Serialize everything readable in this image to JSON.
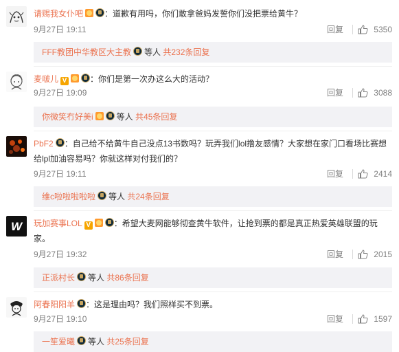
{
  "comments": [
    {
      "username": "请赐我女仆吧",
      "text": "：道歉有用吗，你们敢拿爸妈发誓你们没把票给黄牛？",
      "time": "9月27日 19:11",
      "reply_label": "回复",
      "likes": "5350",
      "badges": [
        "vip-badge",
        "lol-badge"
      ],
      "thread": {
        "user": "FFF教团中华教区大主教",
        "people": "等人",
        "count": "共232条回复"
      }
    },
    {
      "username": "麦啵儿",
      "text": "：你们是第一次办这么大的活动？",
      "time": "9月27日 19:09",
      "reply_label": "回复",
      "likes": "3088",
      "badges": [
        "v-badge",
        "vip-badge",
        "lol-badge"
      ],
      "v_char": "V",
      "thread": {
        "user": "你微笑冇好美i",
        "people": "等人",
        "count": "共45条回复"
      }
    },
    {
      "username": "PbF2",
      "text": "：自己给不给黄牛自己没点13书数吗？玩弄我们lol撸友感情？大家想在家门口看场比赛想给lpl加油容易吗？你就这样对付我们的？",
      "time": "9月27日 19:11",
      "reply_label": "回复",
      "likes": "2414",
      "badges": [
        "lol-badge"
      ],
      "thread": {
        "user": "维c啦啦啦啦啦",
        "people": "等人",
        "count": "共24条回复"
      }
    },
    {
      "username": "玩加赛事LOL",
      "text": "：希望大麦网能够彻查黄牛软件，让抢到票的都是真正热爱英雄联盟的玩家。",
      "time": "9月27日 19:32",
      "reply_label": "回复",
      "likes": "2015",
      "badges": [
        "v-badge",
        "vip-badge",
        "lol-badge"
      ],
      "v_char": "V",
      "thread": {
        "user": "正派村长",
        "people": "等人",
        "count": "共86条回复"
      }
    },
    {
      "username": "阿春阳阳羊",
      "text": "：这是理由吗？我们照样买不到票。",
      "time": "9月27日 19:10",
      "reply_label": "回复",
      "likes": "1597",
      "badges": [
        "lol-badge"
      ],
      "thread": {
        "user": "一笙爱曦",
        "people": "等人",
        "count": "共25条回复"
      }
    }
  ],
  "avatar_logo_text": "W",
  "colors": {
    "username": "#eb7350",
    "text": "#333333",
    "meta": "#808080",
    "reply_bg": "#f2f2f5"
  }
}
